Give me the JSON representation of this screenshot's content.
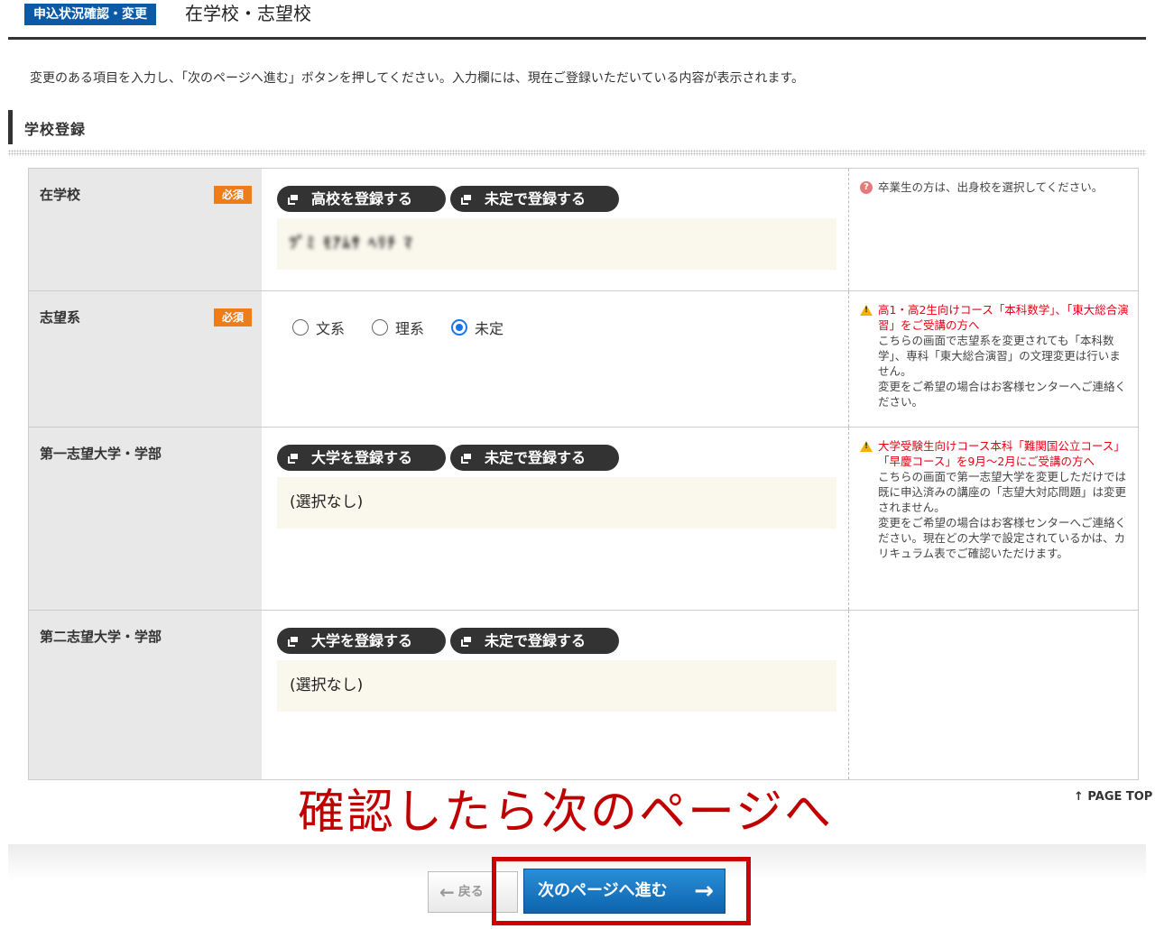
{
  "header": {
    "badge": "申込状況確認・変更",
    "title": "在学校・志望校"
  },
  "intro_text": "変更のある項目を入力し、「次のページへ進む」ボタンを押してください。入力欄には、現在ご登録いただいている内容が表示されます。",
  "section": {
    "title": "学校登録"
  },
  "required_label": "必須",
  "rows": {
    "school": {
      "label": "在学校",
      "buttons": [
        "高校を登録する",
        "未定で登録する"
      ],
      "value": "ﾂﾞﾐ ﾓｱﾑｻ ﾍﾘﾁ ﾏ",
      "note": "卒業生の方は、出身校を選択してください。"
    },
    "track": {
      "label": "志望系",
      "options": [
        "文系",
        "理系",
        "未定"
      ],
      "selected": "未定",
      "note_title": "高1・高2生向けコース「本科数学」、「東大総合演習」をご受講の方へ",
      "note_body": "こちらの画面で志望系を変更されても「本科数学」、専科「東大総合演習」の文理変更は行いません。",
      "note_body2": "変更をご希望の場合はお客様センターへご連絡ください。"
    },
    "first_choice": {
      "label": "第一志望大学・学部",
      "buttons": [
        "大学を登録する",
        "未定で登録する"
      ],
      "value": "(選択なし)",
      "note_title": "大学受験生向けコース本科「難関国公立コース」「早慶コース」を9月～2月にご受講の方へ",
      "note_body": "こちらの画面で第一志望大学を変更しただけでは既に申込済みの講座の「志望大対応問題」は変更されません。",
      "note_body2": "変更をご希望の場合はお客様センターへご連絡ください。現在どの大学で設定されているかは、カリキュラム表でご確認いただけます。"
    },
    "second_choice": {
      "label": "第二志望大学・学部",
      "buttons": [
        "大学を登録する",
        "未定で登録する"
      ],
      "value": "(選択なし)"
    }
  },
  "page_top": "↑ PAGE TOP",
  "overlay_caption": "確認したら次のページへ",
  "footer": {
    "back_label": "戻る",
    "next_label": "次のページへ進む"
  },
  "colors": {
    "brand_blue": "#0c5aa6",
    "required_orange": "#ee7d18",
    "warning_red": "#e60012",
    "highlight_red": "#cc0000",
    "label_bg": "#e8e8e8",
    "value_bg": "#faf8ec"
  },
  "icons": {
    "button_icon": "window-stack-icon",
    "note_help": "question-icon",
    "note_warning": "warning-icon",
    "next_arrow": "arrow-right-icon",
    "back_arrow": "arrow-left-icon"
  }
}
